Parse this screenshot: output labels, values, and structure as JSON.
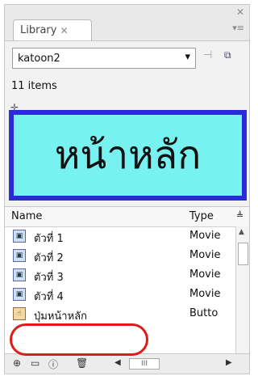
{
  "tab": {
    "title": "Library",
    "close": "✕"
  },
  "window": {
    "close": "✕",
    "menu": "▾≡"
  },
  "library_select": {
    "value": "katoon2"
  },
  "item_count": "11 items",
  "preview": {
    "text": "หน้าหลัก",
    "background": "#78f2f0",
    "border": "#2a2ad8"
  },
  "columns": {
    "name": "Name",
    "type": "Type"
  },
  "rows": [
    {
      "name": "ตัวที่ 1",
      "type": "Movie"
    },
    {
      "name": "ตัวที่ 2",
      "type": "Movie"
    },
    {
      "name": "ตัวที่ 3",
      "type": "Movie"
    },
    {
      "name": "ตัวที่ 4",
      "type": "Movie"
    },
    {
      "name": "ปุ่มหน้าหลัก",
      "type": "Butto"
    }
  ],
  "highlight_color": "#e11a1a",
  "toolbar": {
    "scroll_thumb": "III"
  }
}
